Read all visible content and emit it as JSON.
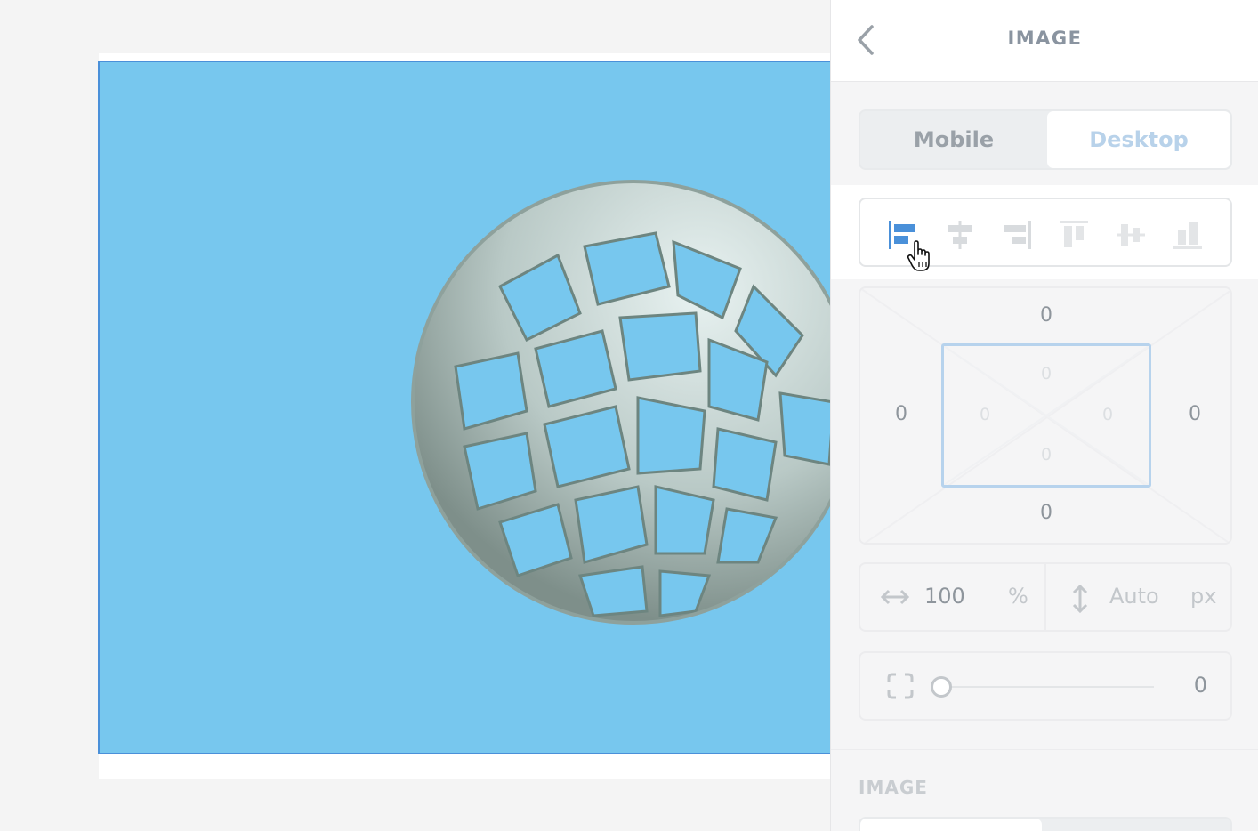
{
  "panel": {
    "title": "IMAGE",
    "device_tabs": {
      "mobile": "Mobile",
      "desktop": "Desktop",
      "selected": "Desktop"
    },
    "alignment": {
      "options": [
        "align-left",
        "align-center-horizontal",
        "align-right",
        "align-top",
        "align-center-vertical",
        "align-bottom"
      ],
      "active": "align-left"
    },
    "spacing": {
      "margin": {
        "top": "0",
        "right": "0",
        "bottom": "0",
        "left": "0"
      },
      "padding": {
        "top": "0",
        "right": "0",
        "bottom": "0",
        "left": "0"
      }
    },
    "size": {
      "width_value": "100",
      "width_unit": "%",
      "height_placeholder": "Auto",
      "height_unit": "px"
    },
    "radius": {
      "value": "0"
    },
    "next_section_label": "IMAGE"
  },
  "colors": {
    "accent": "#4a90d9",
    "canvas_image_bg": "#77c7ee",
    "selected_tab_text": "#b8d2ea"
  }
}
